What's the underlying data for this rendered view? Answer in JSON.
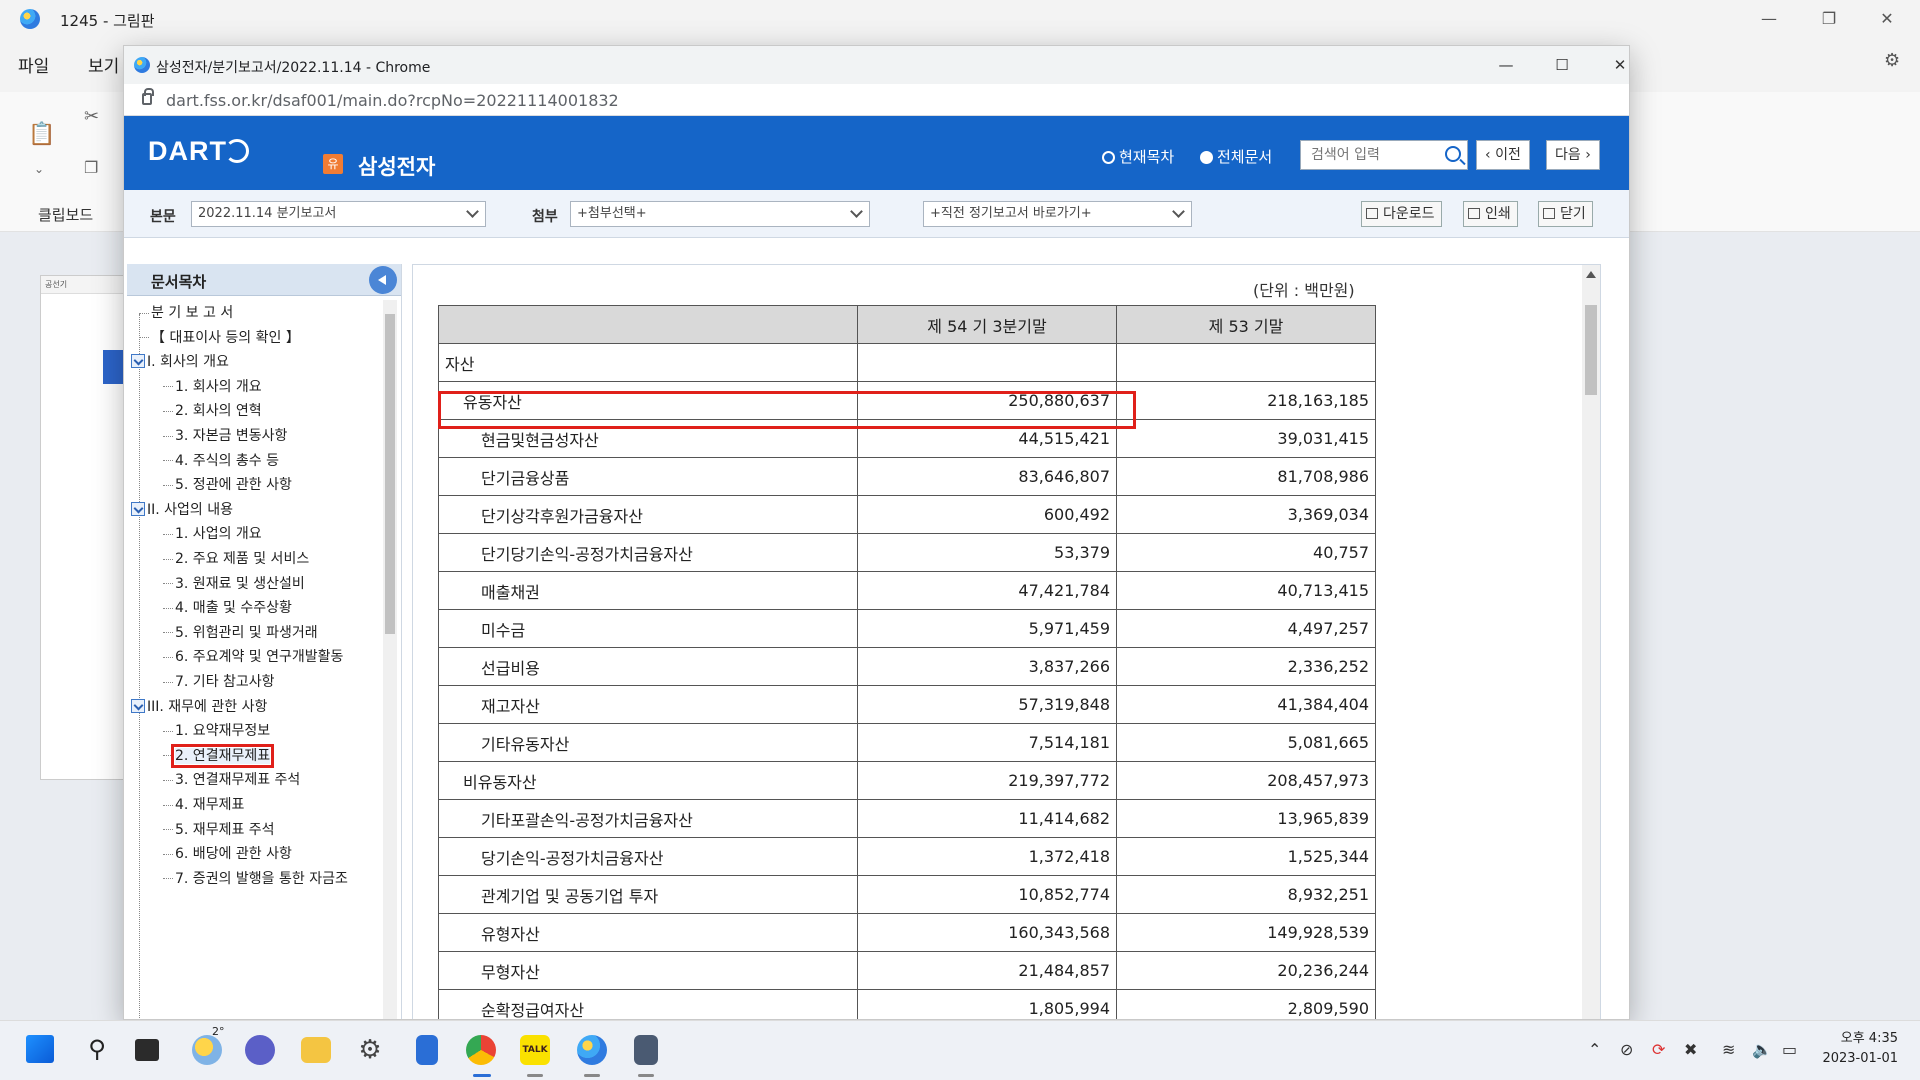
{
  "paint": {
    "title": "1245 - 그림판",
    "menu": [
      "파일",
      "보기"
    ],
    "clipboard_label": "클립보드",
    "thumb_label": "공선기"
  },
  "chrome": {
    "title": "삼성전자/분기보고서/2022.11.14 - Chrome",
    "url": "dart.fss.or.kr/dsaf001/main.do?rcpNo=20221114001832",
    "minimize": "—",
    "maximize": "☐",
    "close": "✕"
  },
  "dart": {
    "logo": "DART",
    "company_badge": "유",
    "company_name": "삼성전자",
    "radio_current": "현재목차",
    "radio_all": "전체문서",
    "search_placeholder": "검색어 입력",
    "prev_label": "이전",
    "next_label": "다음"
  },
  "toolbar": {
    "main_label": "본문",
    "main_select": "2022.11.14  분기보고서",
    "attach_label": "첨부",
    "attach_select": "+첨부선택+",
    "recent_select": "+직전 정기보고서 바로가기+",
    "download": "다운로드",
    "print": "인쇄",
    "close": "닫기"
  },
  "toc": {
    "header": "문서목차",
    "items": [
      {
        "label": "분 기 보 고 서",
        "level": 0,
        "toggle": false
      },
      {
        "label": "【 대표이사 등의 확인 】",
        "level": 0,
        "toggle": false
      },
      {
        "label": "I. 회사의 개요",
        "level": 0,
        "toggle": true
      },
      {
        "label": "1. 회사의 개요",
        "level": 1,
        "toggle": false
      },
      {
        "label": "2. 회사의 연혁",
        "level": 1,
        "toggle": false
      },
      {
        "label": "3. 자본금 변동사항",
        "level": 1,
        "toggle": false
      },
      {
        "label": "4. 주식의 총수 등",
        "level": 1,
        "toggle": false
      },
      {
        "label": "5. 정관에 관한 사항",
        "level": 1,
        "toggle": false
      },
      {
        "label": "II. 사업의 내용",
        "level": 0,
        "toggle": true
      },
      {
        "label": "1. 사업의 개요",
        "level": 1,
        "toggle": false
      },
      {
        "label": "2. 주요 제품 및 서비스",
        "level": 1,
        "toggle": false
      },
      {
        "label": "3. 원재료 및 생산설비",
        "level": 1,
        "toggle": false
      },
      {
        "label": "4. 매출 및 수주상황",
        "level": 1,
        "toggle": false
      },
      {
        "label": "5. 위험관리 및 파생거래",
        "level": 1,
        "toggle": false
      },
      {
        "label": "6. 주요계약 및 연구개발활동",
        "level": 1,
        "toggle": false
      },
      {
        "label": "7. 기타 참고사항",
        "level": 1,
        "toggle": false
      },
      {
        "label": "III. 재무에 관한 사항",
        "level": 0,
        "toggle": true
      },
      {
        "label": "1. 요약재무정보",
        "level": 1,
        "toggle": false
      },
      {
        "label": "2. 연결재무제표",
        "level": 1,
        "toggle": false,
        "selected": true
      },
      {
        "label": "3. 연결재무제표 주석",
        "level": 1,
        "toggle": false
      },
      {
        "label": "4. 재무제표",
        "level": 1,
        "toggle": false
      },
      {
        "label": "5. 재무제표 주석",
        "level": 1,
        "toggle": false
      },
      {
        "label": "6. 배당에 관한 사항",
        "level": 1,
        "toggle": false
      },
      {
        "label": "7. 증권의 발행을 통한 자금조",
        "level": 1,
        "toggle": false
      }
    ]
  },
  "document": {
    "unit": "(단위 : 백만원)",
    "columns": [
      "",
      "제 54 기 3분기말",
      "제 53 기말"
    ],
    "rows": [
      {
        "label": "자산",
        "level": 0,
        "cur": "",
        "prev": ""
      },
      {
        "label": "유동자산",
        "level": 1,
        "cur": "250,880,637",
        "prev": "218,163,185",
        "highlight": true
      },
      {
        "label": "현금및현금성자산",
        "level": 2,
        "cur": "44,515,421",
        "prev": "39,031,415"
      },
      {
        "label": "단기금융상품",
        "level": 2,
        "cur": "83,646,807",
        "prev": "81,708,986"
      },
      {
        "label": "단기상각후원가금융자산",
        "level": 2,
        "cur": "600,492",
        "prev": "3,369,034"
      },
      {
        "label": "단기당기손익-공정가치금융자산",
        "level": 2,
        "cur": "53,379",
        "prev": "40,757"
      },
      {
        "label": "매출채권",
        "level": 2,
        "cur": "47,421,784",
        "prev": "40,713,415"
      },
      {
        "label": "미수금",
        "level": 2,
        "cur": "5,971,459",
        "prev": "4,497,257"
      },
      {
        "label": "선급비용",
        "level": 2,
        "cur": "3,837,266",
        "prev": "2,336,252"
      },
      {
        "label": "재고자산",
        "level": 2,
        "cur": "57,319,848",
        "prev": "41,384,404"
      },
      {
        "label": "기타유동자산",
        "level": 2,
        "cur": "7,514,181",
        "prev": "5,081,665"
      },
      {
        "label": "비유동자산",
        "level": 1,
        "cur": "219,397,772",
        "prev": "208,457,973"
      },
      {
        "label": "기타포괄손익-공정가치금융자산",
        "level": 2,
        "cur": "11,414,682",
        "prev": "13,965,839"
      },
      {
        "label": "당기손익-공정가치금융자산",
        "level": 2,
        "cur": "1,372,418",
        "prev": "1,525,344"
      },
      {
        "label": "관계기업 및 공동기업 투자",
        "level": 2,
        "cur": "10,852,774",
        "prev": "8,932,251"
      },
      {
        "label": "유형자산",
        "level": 2,
        "cur": "160,343,568",
        "prev": "149,928,539"
      },
      {
        "label": "무형자산",
        "level": 2,
        "cur": "21,484,857",
        "prev": "20,236,244"
      },
      {
        "label": "순확정급여자산",
        "level": 2,
        "cur": "1,805,994",
        "prev": "2,809,590"
      }
    ]
  },
  "taskbar": {
    "weather_temp": "2°",
    "time": "오후 4:35",
    "date": "2023-01-01",
    "kakao": "TALK"
  }
}
